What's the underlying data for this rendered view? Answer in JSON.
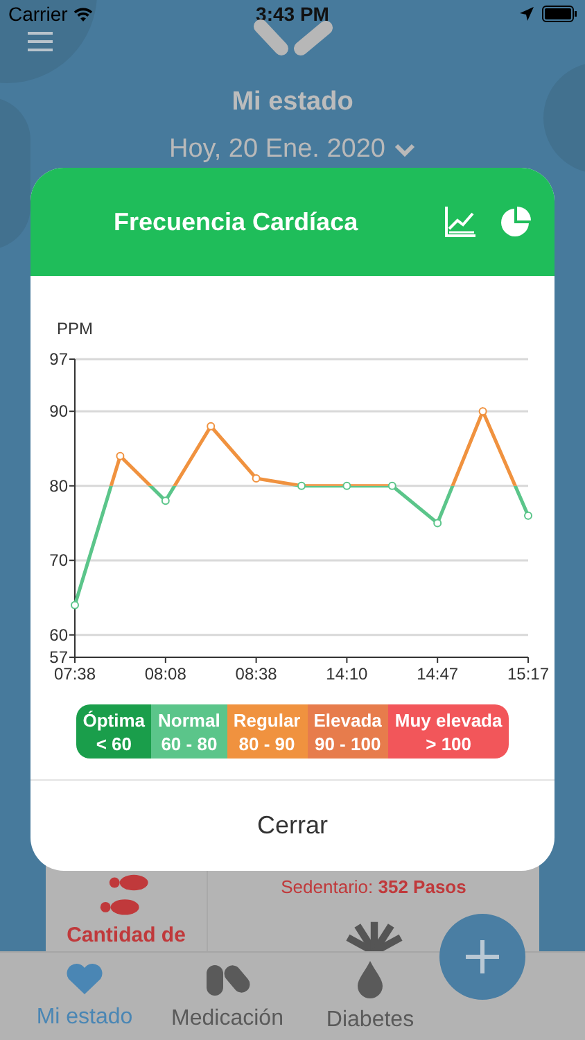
{
  "status_bar": {
    "carrier": "Carrier",
    "time": "3:43 PM"
  },
  "header": {
    "title": "Mi estado",
    "date": "Hoy, 20 Ene. 2020"
  },
  "summary_card": {
    "steps_label": "Cantidad de",
    "sedentary": "Sedentario: **352 Pasos**"
  },
  "modal": {
    "title": "Frecuencia Cardíaca",
    "chart_data": {
      "type": "line",
      "ylabel": "PPM",
      "categories": [
        "07:38",
        null,
        "08:08",
        null,
        "08:38",
        null,
        "14:10",
        null,
        "14:47",
        null,
        "15:17"
      ],
      "series": [
        {
          "color": "#f0923f",
          "marker": "o",
          "values": [
            64,
            84,
            78,
            88,
            81,
            80,
            80,
            80,
            75,
            90,
            76
          ]
        }
      ],
      "grid": true,
      "ylim": [
        57,
        97
      ],
      "yticks": [
        57,
        60,
        70,
        80,
        90,
        97
      ]
    },
    "legend": [
      {
        "label": "Óptima",
        "range": "< 60",
        "color": "#1a9e4b"
      },
      {
        "label": "Normal",
        "range": "60 - 80",
        "color": "#5bc58a"
      },
      {
        "label": "Regular",
        "range": "80 - 90",
        "color": "#f0923f"
      },
      {
        "label": "Elevada",
        "range": "90 - 100",
        "color": "#e77c4c"
      },
      {
        "label": "Muy elevada",
        "range": "> 100",
        "color": "#f2565a"
      }
    ],
    "close_button": "Cerrar"
  },
  "tab_bar": [
    {
      "label": "Mi estado",
      "selected": true
    },
    {
      "label": "Medicación",
      "selected": false
    },
    {
      "label": "Diabetes",
      "selected": false
    }
  ]
}
